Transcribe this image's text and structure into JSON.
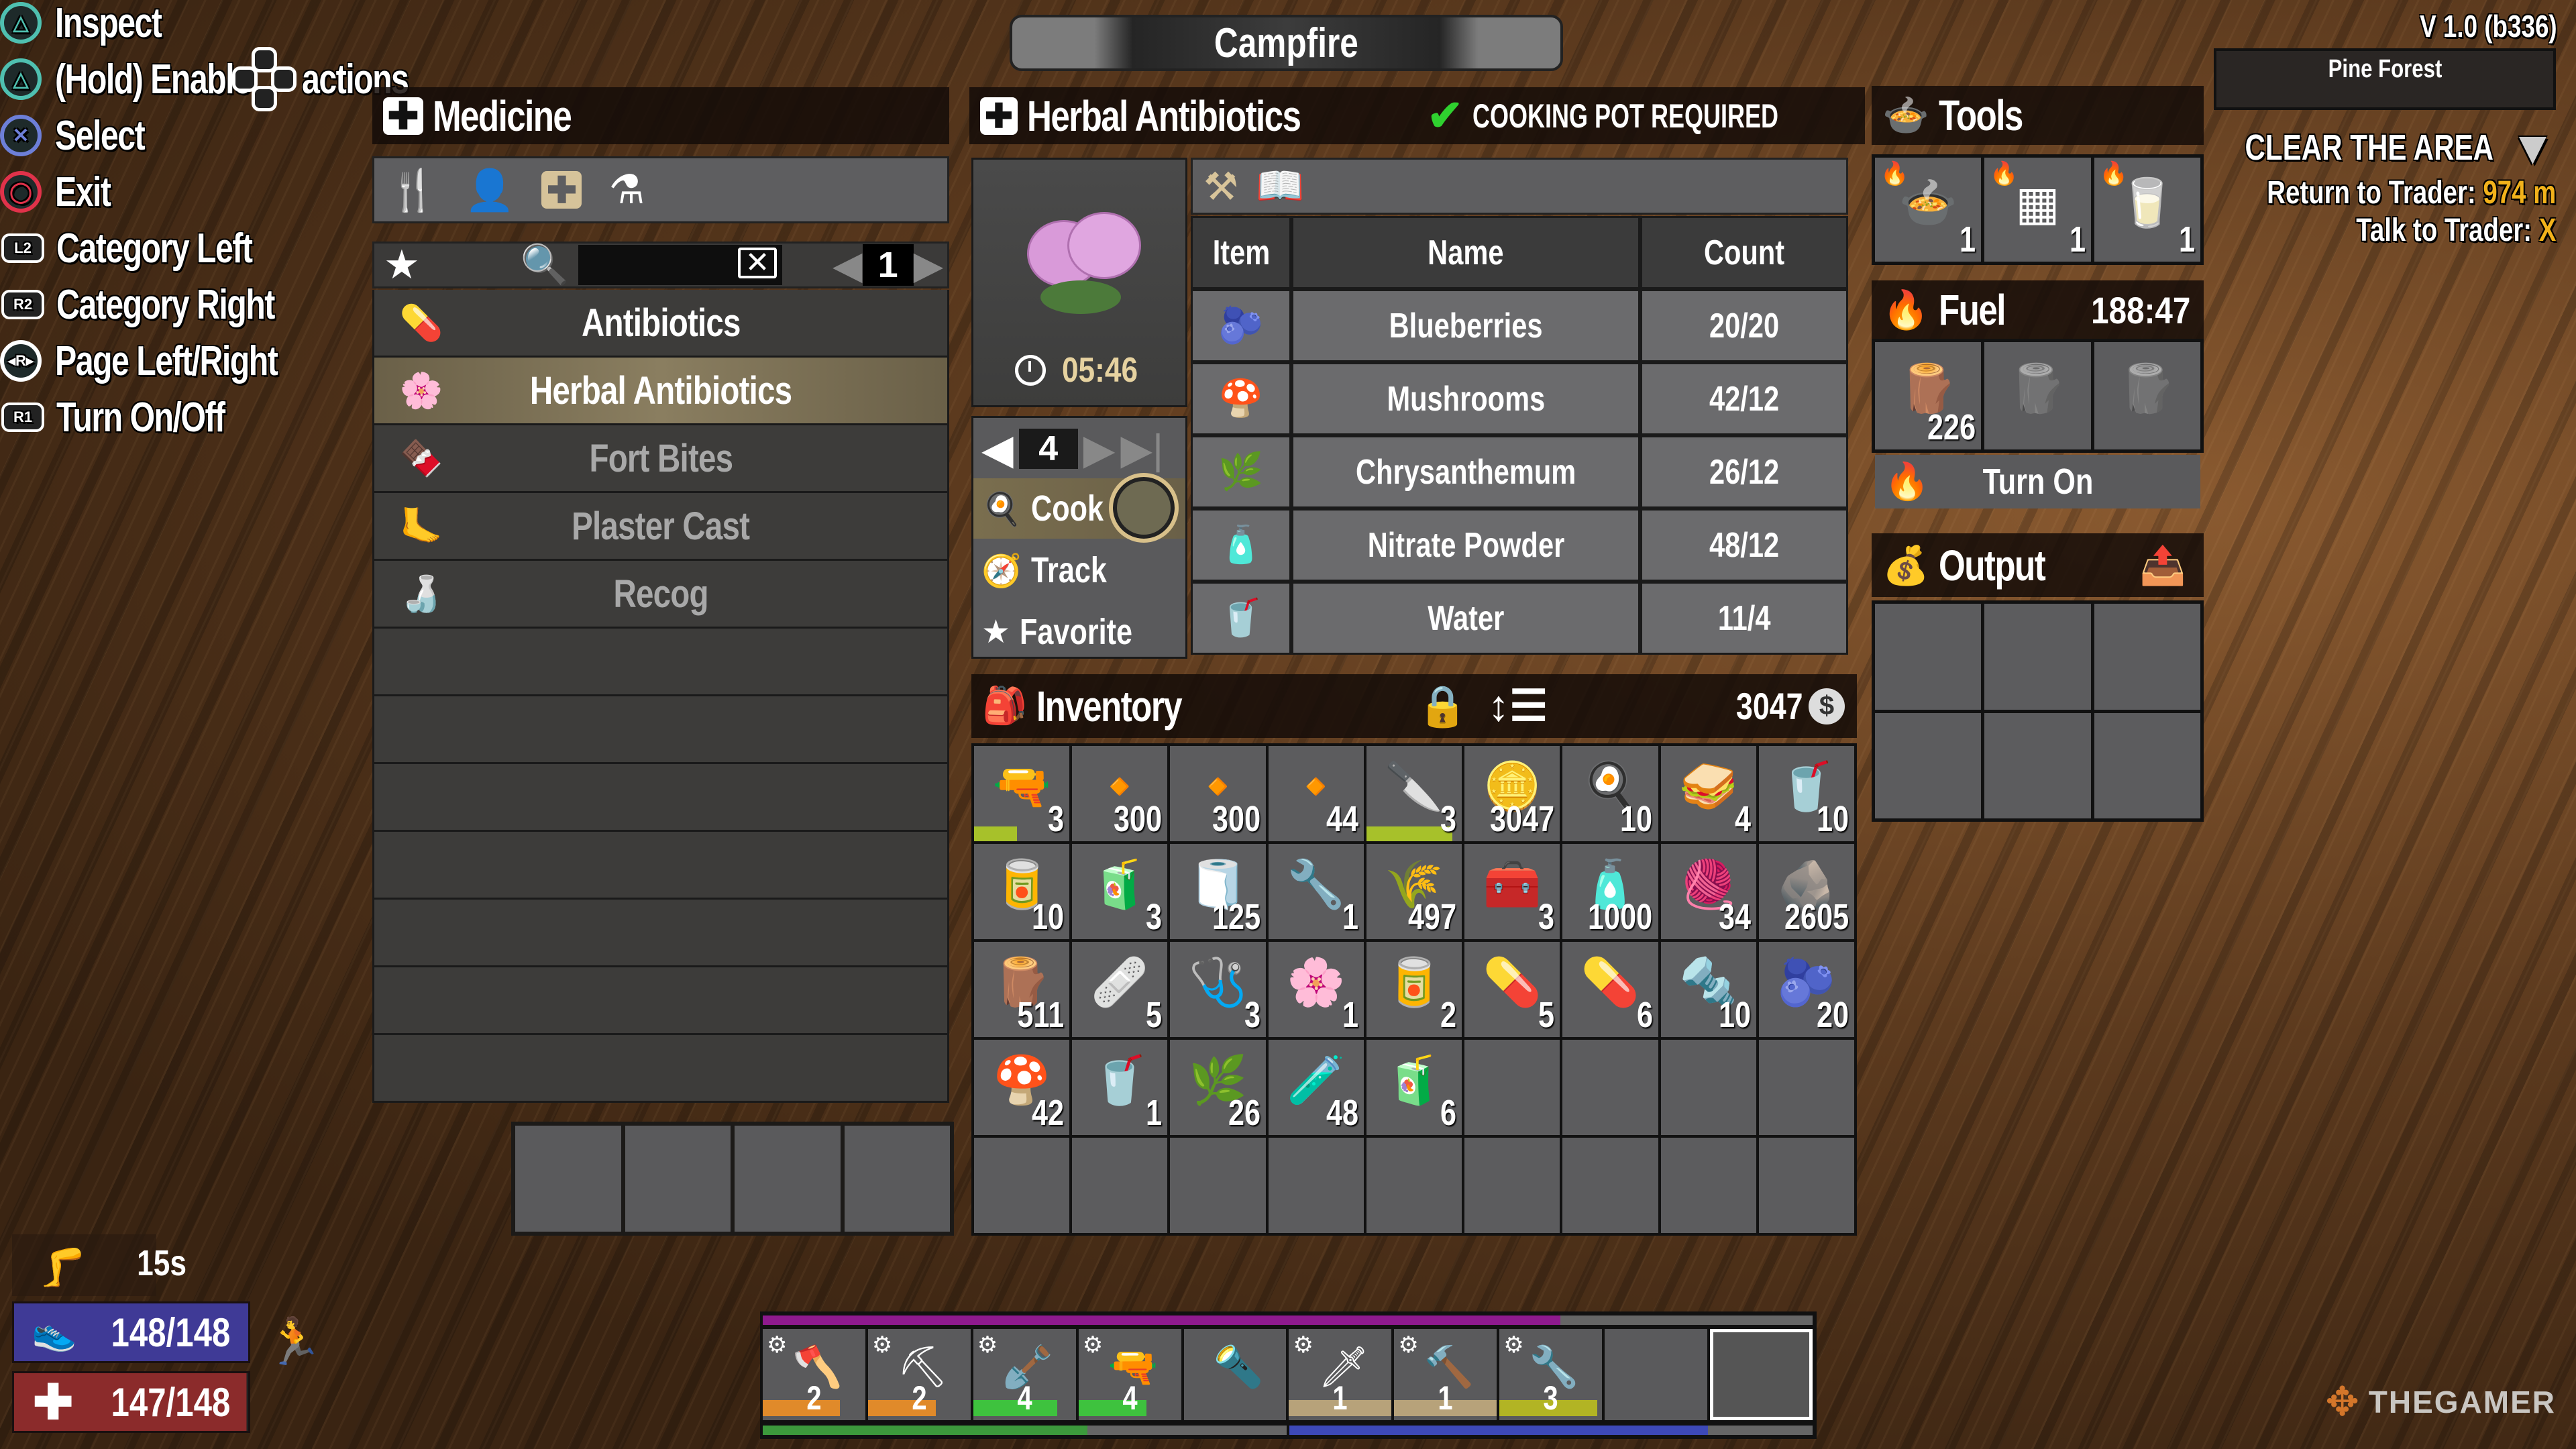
{
  "hints": [
    {
      "button": "triangle",
      "glyph": "△",
      "color": "#4fc0b0",
      "label": "Inspect"
    },
    {
      "button": "triangle",
      "glyph": "△",
      "color": "#4fc0b0",
      "label": "(Hold) Enable",
      "suffix": "actions"
    },
    {
      "button": "cross",
      "glyph": "✕",
      "color": "#6d7fd8",
      "label": "Select"
    },
    {
      "button": "circle",
      "glyph": "◯",
      "color": "#e0324a",
      "label": "Exit"
    },
    {
      "button": "L2",
      "glyph": "L2",
      "label": "Category Left"
    },
    {
      "button": "R2",
      "glyph": "R2",
      "label": "Category Right"
    },
    {
      "button": "R-stick",
      "glyph": "◂R▸",
      "label": "Page Left/Right"
    },
    {
      "button": "R1",
      "glyph": "R1",
      "label": "Turn On/Off"
    }
  ],
  "window_title": "Campfire",
  "version": "V 1.0 (b336)",
  "biome": "Pine Forest",
  "quest": {
    "title": "CLEAR THE AREA",
    "return_label": "Return to Trader:",
    "return_distance": "974 m",
    "talk_label": "Talk to Trader:",
    "talk_key": "X"
  },
  "medicine": {
    "title": "Medicine",
    "category_icons": [
      "fork-icon",
      "person-eating-icon",
      "medkit-icon",
      "flask-icon"
    ],
    "active_category": "medkit-icon",
    "search_placeholder": "",
    "search_value": "",
    "page": "1",
    "recipes": [
      {
        "name": "Antibiotics",
        "icon": "💊",
        "state": "available"
      },
      {
        "name": "Herbal Antibiotics",
        "icon": "🌸",
        "state": "selected"
      },
      {
        "name": "Fort Bites",
        "icon": "🍫",
        "state": "locked"
      },
      {
        "name": "Plaster Cast",
        "icon": "🦶",
        "state": "locked"
      },
      {
        "name": "Recog",
        "icon": "🍶",
        "state": "locked"
      }
    ],
    "empty_rows": 7,
    "queue_slots": 4
  },
  "recipe": {
    "title": "Herbal Antibiotics",
    "requirement": "COOKING POT REQUIRED",
    "requirement_met": true,
    "craft_time": "05:46",
    "quantity": "4",
    "actions": [
      {
        "label": "Cook",
        "icon": "spatula-icon",
        "glyph": "🍳"
      },
      {
        "label": "Track",
        "icon": "compass-icon",
        "glyph": "🧭"
      },
      {
        "label": "Favorite",
        "icon": "star-icon",
        "glyph": "★"
      }
    ],
    "ingredient_headers": {
      "item": "Item",
      "name": "Name",
      "count": "Count"
    },
    "ingredients": [
      {
        "icon": "🫐",
        "name": "Blueberries",
        "count": "20/20"
      },
      {
        "icon": "🍄",
        "name": "Mushrooms",
        "count": "42/12"
      },
      {
        "icon": "🌿",
        "name": "Chrysanthemum",
        "count": "26/12"
      },
      {
        "icon": "🧴",
        "name": "Nitrate Powder",
        "count": "48/12"
      },
      {
        "icon": "🥤",
        "name": "Water",
        "count": "11/4"
      }
    ]
  },
  "inventory": {
    "title": "Inventory",
    "currency": "3047",
    "slots": [
      {
        "icon": "🔫",
        "count": "3",
        "quality_color": "#a7c12a",
        "quality": 0.45
      },
      {
        "icon": "🔸",
        "count": "300"
      },
      {
        "icon": "🔸",
        "count": "300"
      },
      {
        "icon": "🔸",
        "count": "44"
      },
      {
        "icon": "🔪",
        "count": "3",
        "quality_color": "#a7c12a",
        "quality": 0.9
      },
      {
        "icon": "🪙",
        "count": "3047"
      },
      {
        "icon": "🍳",
        "count": "10"
      },
      {
        "icon": "🥪",
        "count": "4"
      },
      {
        "icon": "🥤",
        "count": "10"
      },
      {
        "icon": "🥫",
        "count": "10"
      },
      {
        "icon": "🧃",
        "count": "3"
      },
      {
        "icon": "🧻",
        "count": "125"
      },
      {
        "icon": "🔧",
        "count": "1"
      },
      {
        "icon": "🌾",
        "count": "497"
      },
      {
        "icon": "🧰",
        "count": "3"
      },
      {
        "icon": "🧴",
        "count": "1000"
      },
      {
        "icon": "🧶",
        "count": "34"
      },
      {
        "icon": "🪨",
        "count": "2605"
      },
      {
        "icon": "🪵",
        "count": "511"
      },
      {
        "icon": "🩹",
        "count": "5"
      },
      {
        "icon": "🩺",
        "count": "3"
      },
      {
        "icon": "🌸",
        "count": "1"
      },
      {
        "icon": "🥫",
        "count": "2"
      },
      {
        "icon": "💊",
        "count": "5"
      },
      {
        "icon": "💊",
        "count": "6"
      },
      {
        "icon": "🔩",
        "count": "10"
      },
      {
        "icon": "🫐",
        "count": "20"
      },
      {
        "icon": "🍄",
        "count": "42"
      },
      {
        "icon": "🥤",
        "count": "1"
      },
      {
        "icon": "🌿",
        "count": "26"
      },
      {
        "icon": "🧪",
        "count": "48"
      },
      {
        "icon": "🧃",
        "count": "6"
      }
    ],
    "total_slots": 45
  },
  "tools": {
    "title": "Tools",
    "slots": [
      {
        "icon": "🍲",
        "name": "cooking-pot",
        "count": "1"
      },
      {
        "icon": "▦",
        "name": "grill",
        "count": "1"
      },
      {
        "icon": "🥛",
        "name": "beaker",
        "count": "1"
      }
    ]
  },
  "fuel": {
    "title": "Fuel",
    "time": "188:47",
    "slots": [
      {
        "icon": "🪵",
        "count": "226",
        "active": true
      },
      {
        "icon": "🪵",
        "count": "",
        "active": false
      },
      {
        "icon": "🪵",
        "count": "",
        "active": false
      }
    ],
    "toggle_label": "Turn On"
  },
  "output": {
    "title": "Output",
    "slots": 6
  },
  "player": {
    "debuff_timer": "15s",
    "stamina": "148/148",
    "stamina_fraction": 1.0,
    "health": "147/148",
    "health_fraction": 0.993,
    "stamina_color": "#3f3a96",
    "health_color": "#8b2b2b"
  },
  "toolbelt": {
    "xp_fraction": 0.76,
    "slots": [
      {
        "icon": "🪓",
        "count": "2",
        "modded": true,
        "quality_color": "#e08a2a",
        "quality": 0.75
      },
      {
        "icon": "⛏",
        "count": "2",
        "modded": true,
        "quality_color": "#e08a2a",
        "quality": 0.66
      },
      {
        "icon": "🪏",
        "count": "4",
        "modded": true,
        "quality_color": "#3ec23e",
        "quality": 0.82
      },
      {
        "icon": "🔫",
        "count": "4",
        "modded": true,
        "quality_color": "#3ec23e",
        "quality": 0.66
      },
      {
        "icon": "🔦",
        "count": "",
        "modded": false
      },
      {
        "icon": "🗡",
        "count": "1",
        "modded": true,
        "quality_color": "#b7a27a",
        "quality": 1.0
      },
      {
        "icon": "🔨",
        "count": "1",
        "modded": true,
        "quality_color": "#b7a27a",
        "quality": 1.0
      },
      {
        "icon": "🔧",
        "count": "3",
        "modded": true,
        "quality_color": "#b2b424",
        "quality": 0.95
      },
      {
        "icon": "",
        "count": "",
        "modded": false
      },
      {
        "icon": "",
        "count": "",
        "modded": false,
        "active": true
      }
    ],
    "bottom_bars": [
      {
        "color": "#3c9a3c",
        "fraction": 0.62
      },
      {
        "color": "#3d49b8",
        "fraction": 0.8
      }
    ]
  },
  "watermark": "THEGAMER"
}
